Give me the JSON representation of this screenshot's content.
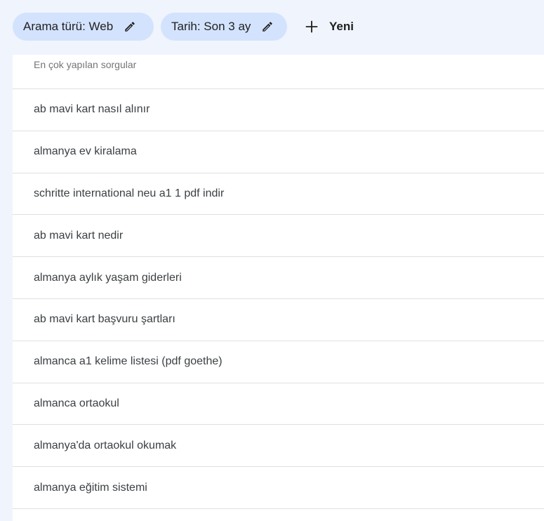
{
  "filters": {
    "chips": [
      {
        "label": "Arama türü: Web"
      },
      {
        "label": "Tarih: Son 3 ay"
      }
    ],
    "new_label": "Yeni"
  },
  "table": {
    "header": "En çok yapılan sorgular",
    "rows": [
      "ab mavi kart nasıl alınır",
      "almanya ev kiralama",
      "schritte international neu a1 1 pdf indir",
      "ab mavi kart nedir",
      "almanya aylık yaşam giderleri",
      "ab mavi kart başvuru şartları",
      "almanca a1 kelime listesi (pdf goethe)",
      "almanca ortaokul",
      "almanya'da ortaokul okumak",
      "almanya eğitim sistemi"
    ]
  },
  "icons": {
    "edit": "pencil-icon",
    "add": "plus-icon"
  }
}
